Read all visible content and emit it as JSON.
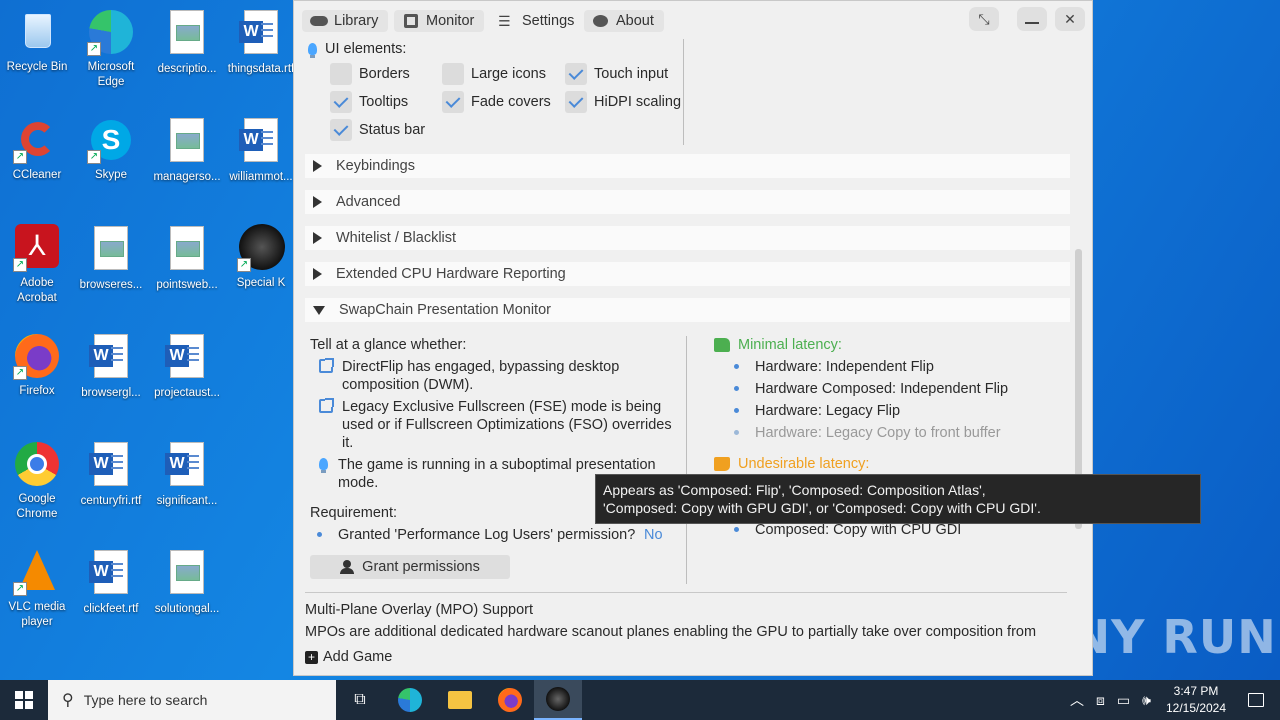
{
  "desktop": {
    "icons": [
      {
        "label": "Recycle Bin"
      },
      {
        "label": "Microsoft Edge"
      },
      {
        "label": "descriptio..."
      },
      {
        "label": "thingsdata.rtf"
      },
      {
        "label": "CCleaner"
      },
      {
        "label": "Skype"
      },
      {
        "label": "managerso..."
      },
      {
        "label": "williammot..."
      },
      {
        "label": "Adobe Acrobat"
      },
      {
        "label": "browseres..."
      },
      {
        "label": "pointsweb..."
      },
      {
        "label": "Special K"
      },
      {
        "label": "Firefox"
      },
      {
        "label": "browsergl..."
      },
      {
        "label": "projectaust..."
      },
      {
        "label": "Google Chrome"
      },
      {
        "label": "centuryfri.rtf"
      },
      {
        "label": "significant..."
      },
      {
        "label": "VLC media player"
      },
      {
        "label": "clickfeet.rtf"
      },
      {
        "label": "solutiongal..."
      }
    ]
  },
  "app": {
    "tabs": [
      {
        "label": "Library"
      },
      {
        "label": "Monitor"
      },
      {
        "label": "Settings"
      },
      {
        "label": "About"
      }
    ],
    "ui_elements": {
      "title": "UI elements:",
      "options": [
        {
          "label": "Borders",
          "checked": false
        },
        {
          "label": "Large icons",
          "checked": false
        },
        {
          "label": "Touch input",
          "checked": true
        },
        {
          "label": "Tooltips",
          "checked": true
        },
        {
          "label": "Fade covers",
          "checked": true
        },
        {
          "label": "HiDPI scaling",
          "checked": true
        },
        {
          "label": "Status bar",
          "checked": true
        }
      ]
    },
    "sections": [
      {
        "label": "Keybindings"
      },
      {
        "label": "Advanced"
      },
      {
        "label": "Whitelist / Blacklist"
      },
      {
        "label": "Extended CPU Hardware Reporting"
      },
      {
        "label": "SwapChain Presentation Monitor"
      }
    ],
    "swapchain": {
      "glance_title": "Tell at a glance whether:",
      "glance_items": [
        "DirectFlip has engaged, bypassing desktop composition (DWM).",
        "Legacy Exclusive Fullscreen (FSE) mode is being used or if Fullscreen Optimizations (FSO) overrides it.",
        "The game is running in a suboptimal presentation mode."
      ],
      "requirement_title": "Requirement:",
      "requirement_item": "Granted 'Performance Log Users' permission?",
      "requirement_value": "No",
      "grant_button": "Grant permissions",
      "minimal_title": "Minimal latency:",
      "minimal_items": [
        "Hardware: Independent Flip",
        "Hardware Composed: Independent Flip",
        "Hardware: Legacy Flip",
        "Hardware: Legacy Copy to front buffer"
      ],
      "undesirable_title": "Undesirable latency:",
      "undesirable_last": "Composed: Copy with CPU GDI",
      "tooltip_line1": "Appears as 'Composed: Flip', 'Composed: Composition Atlas',",
      "tooltip_line2": "'Composed: Copy with GPU GDI', or 'Composed: Copy with CPU GDI'."
    },
    "mpo": {
      "title": "Multi-Plane Overlay (MPO) Support",
      "text": "MPOs are additional dedicated hardware scanout planes enabling the GPU to partially take over composition from"
    },
    "add_game": "Add Game",
    "colors": {
      "accent": "#4a8ad8",
      "green": "#4caf50",
      "orange": "#f0a020"
    }
  },
  "taskbar": {
    "search_placeholder": "Type here to search",
    "time": "3:47 PM",
    "date": "12/15/2024"
  },
  "watermark": "ANY RUN"
}
